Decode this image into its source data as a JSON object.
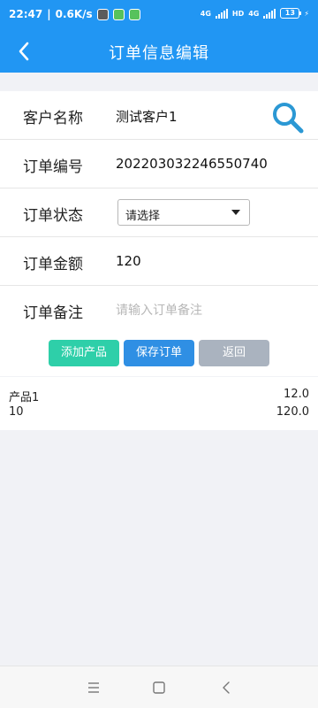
{
  "status_bar": {
    "time": "22:47",
    "speed": "0.6K/s",
    "net1": "4G",
    "net2": "HD",
    "net3": "4G",
    "battery": "13"
  },
  "nav": {
    "title": "订单信息编辑",
    "back_icon": "chevron-left-icon"
  },
  "form": {
    "customer": {
      "label": "客户名称",
      "value": "测试客户1",
      "search_icon": "search-icon"
    },
    "order_no": {
      "label": "订单编号",
      "value": "202203032246550740"
    },
    "status": {
      "label": "订单状态",
      "selected": "请选择"
    },
    "amount": {
      "label": "订单金额",
      "value": "120"
    },
    "remark": {
      "label": "订单备注",
      "placeholder": "请输入订单备注",
      "value": ""
    }
  },
  "buttons": {
    "add_product": "添加产品",
    "save_order": "保存订单",
    "back": "返回"
  },
  "products": [
    {
      "name": "产品1",
      "price": "12.0",
      "quantity": "10",
      "amount": "120.0"
    }
  ],
  "colors": {
    "header": "#2196f3",
    "add_button": "#2ecfa9",
    "save_button": "#2f8fe4",
    "back_button": "#aab3bf",
    "search_icon": "#2b98d4"
  }
}
